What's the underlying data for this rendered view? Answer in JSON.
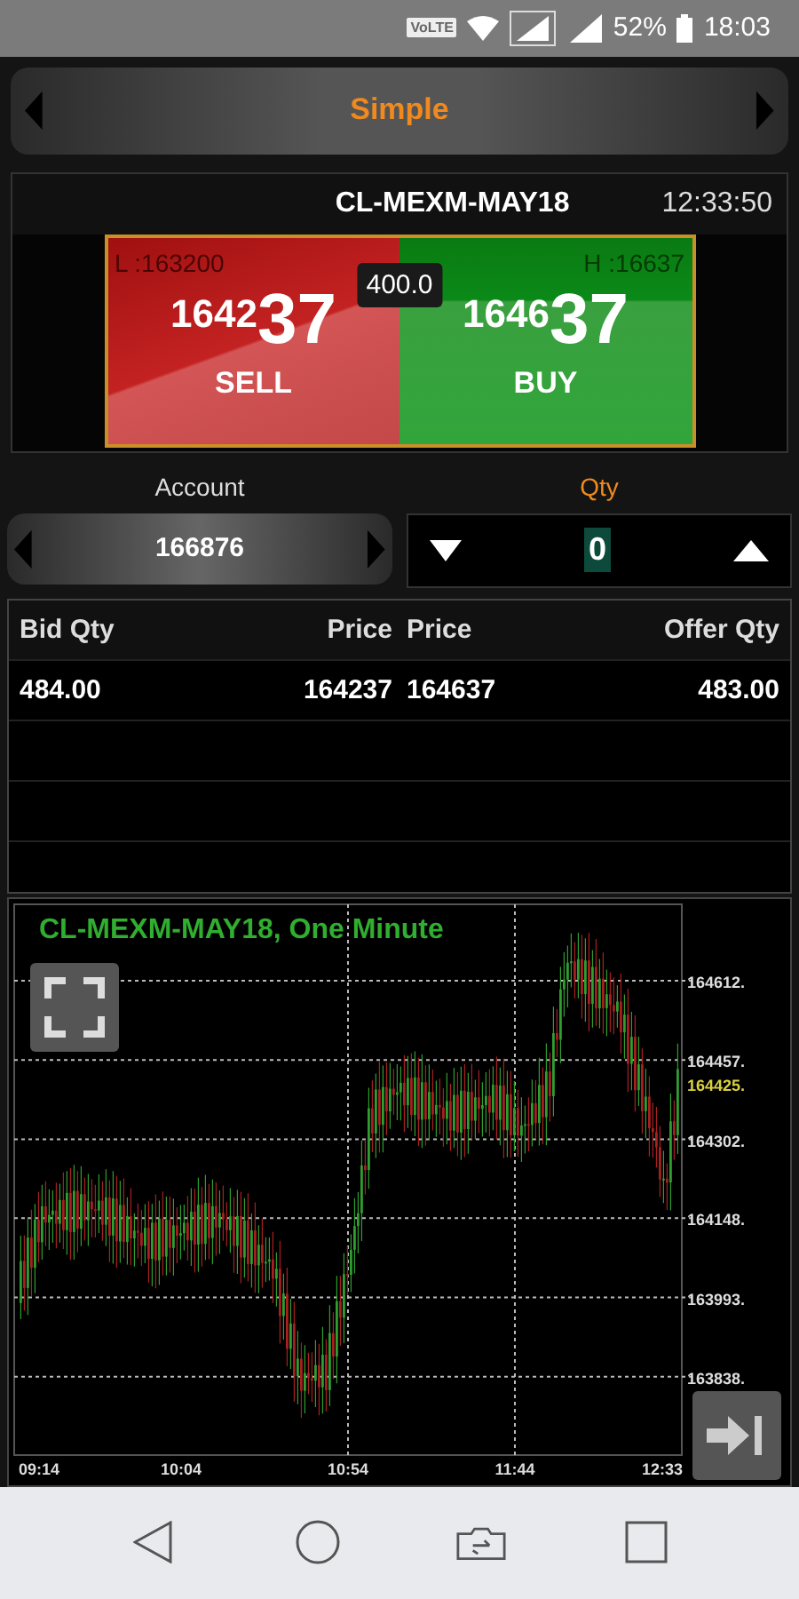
{
  "status_bar": {
    "volte": "VoLTE",
    "battery_percent": "52%",
    "time": "18:03"
  },
  "mode_selector": {
    "label": "Simple"
  },
  "instrument": {
    "symbol": "CL-MEXM-MAY18",
    "time": "12:33:50",
    "spread": "400.0",
    "sides": [
      {
        "kind": "sell",
        "label": "SELL",
        "price_main": "1642",
        "price_pips": "37",
        "extreme": "L :163200"
      },
      {
        "kind": "buy",
        "label": "BUY",
        "price_main": "1646",
        "price_pips": "37",
        "extreme": "H :16637"
      }
    ]
  },
  "account": {
    "label": "Account",
    "value": "166876"
  },
  "qty": {
    "label": "Qty",
    "value": "0"
  },
  "order_book": {
    "columns": [
      "Bid Qty",
      "Price",
      "Price",
      "Offer Qty"
    ],
    "rows": [
      [
        "484.00",
        "164237",
        "164637",
        "483.00"
      ]
    ]
  },
  "chart": {
    "title": "CL-MEXM-MAY18, One Minute",
    "y_labels": [
      "164612.",
      "164457.",
      "164302.",
      "164148.",
      "163993.",
      "163838."
    ],
    "last_price_label": "164425.",
    "x_labels": [
      "09:14",
      "10:04",
      "10:54",
      "11:44",
      "12:33"
    ]
  }
}
